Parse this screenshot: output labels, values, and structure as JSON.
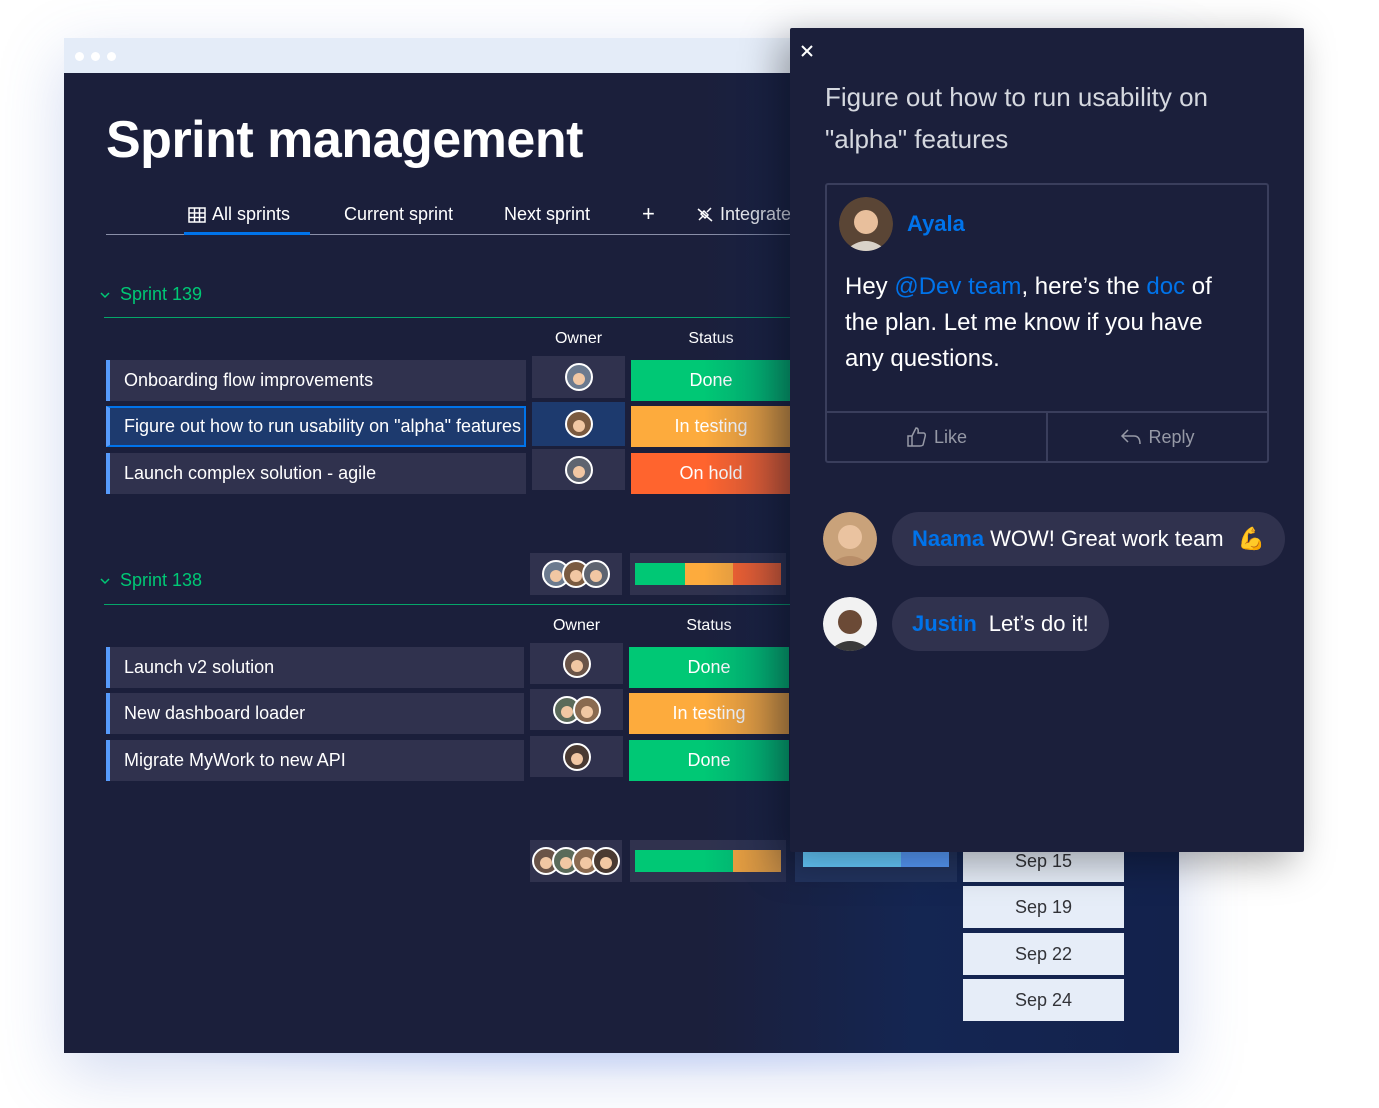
{
  "board": {
    "title": "Sprint management",
    "tabs": [
      {
        "label": "All sprints",
        "icon": "table-icon"
      },
      {
        "label": "Current sprint"
      },
      {
        "label": "Next sprint"
      },
      {
        "label": "+"
      },
      {
        "label": "Integrate",
        "icon": "integrate-icon"
      }
    ],
    "groups": [
      {
        "name": "Sprint 139",
        "columns": {
          "owner": "Owner",
          "status": "Status"
        },
        "rows": [
          {
            "task": "Onboarding flow improvements",
            "status": "Done"
          },
          {
            "task": "Figure out how to run usability on \"alpha\" features",
            "status": "In testing"
          },
          {
            "task": "Launch complex solution - agile",
            "status": "On hold"
          }
        ]
      },
      {
        "name": "Sprint 138",
        "columns": {
          "owner": "Owner",
          "status": "Status"
        },
        "rows": [
          {
            "task": "Launch v2 solution",
            "status": "Done"
          },
          {
            "task": "New dashboard loader",
            "status": "In testing"
          },
          {
            "task": "Migrate MyWork to new API",
            "status": "Done"
          }
        ]
      }
    ],
    "dates": [
      "Sep 15",
      "Sep 19",
      "Sep 22",
      "Sep 24"
    ],
    "colors": {
      "done": "#00c875",
      "in_testing": "#fdab3d",
      "on_hold": "#ff642e",
      "accent": "#0073ea"
    }
  },
  "panel": {
    "title": "Figure out how to run usability on \"alpha\" features",
    "update": {
      "author": "Ayala",
      "text_before_mention": "Hey ",
      "mention": "@Dev team",
      "text_middle": ", here’s the ",
      "link": "doc",
      "text_after": " of the plan. Let me know if you have any questions."
    },
    "actions": {
      "like": "Like",
      "reply": "Reply"
    },
    "replies": [
      {
        "name": "Naama",
        "text": "WOW! Great work team",
        "emoji": "💪"
      },
      {
        "name": "Justin",
        "text": "Let’s do it!"
      }
    ]
  }
}
